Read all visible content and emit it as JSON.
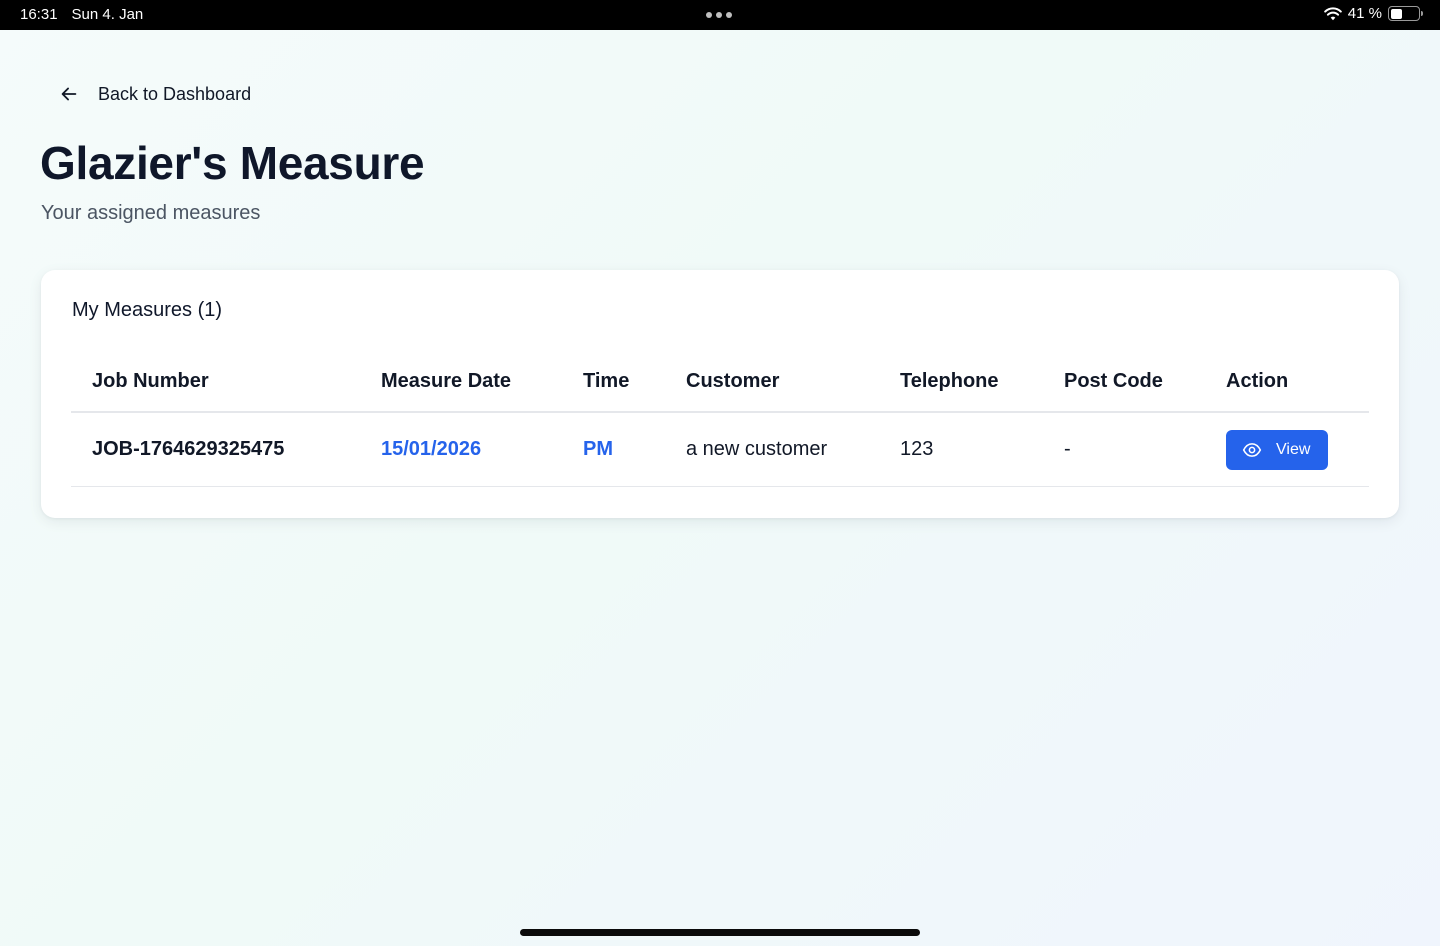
{
  "status_bar": {
    "time": "16:31",
    "date": "Sun 4. Jan",
    "battery_percent_label": "41 %",
    "battery_level": 0.41
  },
  "header": {
    "back_label": "Back to Dashboard",
    "title": "Glazier's Measure",
    "subtitle": "Your assigned measures"
  },
  "card": {
    "title": "My Measures (1)",
    "columns": [
      "Job Number",
      "Measure Date",
      "Time",
      "Customer",
      "Telephone",
      "Post Code",
      "Action"
    ],
    "rows": [
      {
        "job_number": "JOB-1764629325475",
        "measure_date": "15/01/2026",
        "time": "PM",
        "customer": "a new customer",
        "telephone": "123",
        "post_code": "-",
        "action_label": "View"
      }
    ]
  },
  "colors": {
    "accent": "#2563eb",
    "title": "#0f172a"
  },
  "icons": {
    "back": "arrow-left-icon",
    "view": "eye-icon",
    "wifi": "wifi-icon",
    "battery": "battery-icon"
  }
}
